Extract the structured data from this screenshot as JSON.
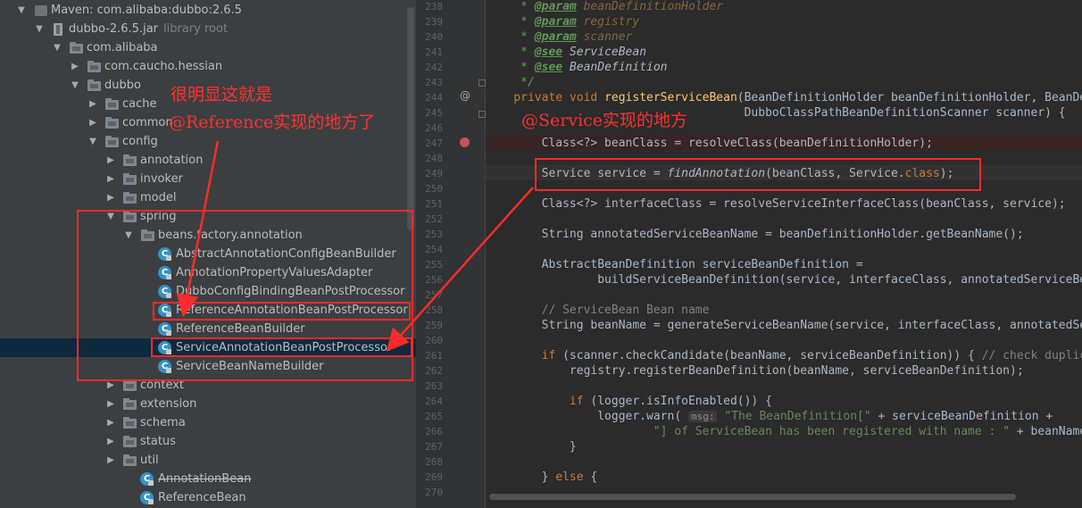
{
  "tree": {
    "items": [
      {
        "label": "Maven: com.alibaba:dubbo:2.6.5",
        "secondary": "",
        "icon": "maven-library-icon",
        "arrow": "▼",
        "depth": 0,
        "kind": "maven"
      },
      {
        "label": "dubbo-2.6.5.jar",
        "secondary": "library root",
        "icon": "jar-icon",
        "arrow": "▼",
        "depth": 1,
        "kind": "jar"
      },
      {
        "label": "com.alibaba",
        "secondary": "",
        "icon": "package-icon",
        "arrow": "▼",
        "depth": 2,
        "kind": "pkg"
      },
      {
        "label": "com.caucho.hessian",
        "secondary": "",
        "icon": "package-icon",
        "arrow": "▶",
        "depth": 3,
        "kind": "pkg"
      },
      {
        "label": "dubbo",
        "secondary": "",
        "icon": "package-icon",
        "arrow": "▼",
        "depth": 3,
        "kind": "pkg"
      },
      {
        "label": "cache",
        "secondary": "",
        "icon": "package-icon",
        "arrow": "▶",
        "depth": 4,
        "kind": "pkg"
      },
      {
        "label": "common",
        "secondary": "",
        "icon": "package-icon",
        "arrow": "▶",
        "depth": 4,
        "kind": "pkg"
      },
      {
        "label": "config",
        "secondary": "",
        "icon": "package-icon",
        "arrow": "▼",
        "depth": 4,
        "kind": "pkg"
      },
      {
        "label": "annotation",
        "secondary": "",
        "icon": "package-icon",
        "arrow": "▶",
        "depth": 5,
        "kind": "pkg"
      },
      {
        "label": "invoker",
        "secondary": "",
        "icon": "package-icon",
        "arrow": "▶",
        "depth": 5,
        "kind": "pkg"
      },
      {
        "label": "model",
        "secondary": "",
        "icon": "package-icon",
        "arrow": "▶",
        "depth": 5,
        "kind": "pkg"
      },
      {
        "label": "spring",
        "secondary": "",
        "icon": "package-icon",
        "arrow": "▼",
        "depth": 5,
        "kind": "pkg"
      },
      {
        "label": "beans.factory.annotation",
        "secondary": "",
        "icon": "package-icon",
        "arrow": "▼",
        "depth": 6,
        "kind": "pkg"
      },
      {
        "label": "AbstractAnnotationConfigBeanBuilder",
        "secondary": "",
        "icon": "class-icon",
        "arrow": "",
        "depth": 7,
        "kind": "cls"
      },
      {
        "label": "AnnotationPropertyValuesAdapter",
        "secondary": "",
        "icon": "class-icon",
        "arrow": "",
        "depth": 7,
        "kind": "cls"
      },
      {
        "label": "DubboConfigBindingBeanPostProcessor",
        "secondary": "",
        "icon": "class-icon",
        "arrow": "",
        "depth": 7,
        "kind": "cls"
      },
      {
        "label": "ReferenceAnnotationBeanPostProcessor",
        "secondary": "",
        "icon": "class-icon",
        "arrow": "",
        "depth": 7,
        "kind": "cls"
      },
      {
        "label": "ReferenceBeanBuilder",
        "secondary": "",
        "icon": "class-icon",
        "arrow": "",
        "depth": 7,
        "kind": "cls"
      },
      {
        "label": "ServiceAnnotationBeanPostProcessor",
        "secondary": "",
        "icon": "class-icon",
        "arrow": "",
        "depth": 7,
        "kind": "cls",
        "selected": true
      },
      {
        "label": "ServiceBeanNameBuilder",
        "secondary": "",
        "icon": "class-icon",
        "arrow": "",
        "depth": 7,
        "kind": "cls"
      },
      {
        "label": "context",
        "secondary": "",
        "icon": "package-icon",
        "arrow": "▶",
        "depth": 5,
        "kind": "pkg"
      },
      {
        "label": "extension",
        "secondary": "",
        "icon": "package-icon",
        "arrow": "▶",
        "depth": 5,
        "kind": "pkg"
      },
      {
        "label": "schema",
        "secondary": "",
        "icon": "package-icon",
        "arrow": "▶",
        "depth": 5,
        "kind": "pkg"
      },
      {
        "label": "status",
        "secondary": "",
        "icon": "package-icon",
        "arrow": "▶",
        "depth": 5,
        "kind": "pkg"
      },
      {
        "label": "util",
        "secondary": "",
        "icon": "package-icon",
        "arrow": "▶",
        "depth": 5,
        "kind": "pkg"
      },
      {
        "label": "AnnotationBean",
        "secondary": "",
        "icon": "class-icon",
        "arrow": "",
        "depth": 6,
        "kind": "cls",
        "deprecated": true
      },
      {
        "label": "ReferenceBean",
        "secondary": "",
        "icon": "class-icon",
        "arrow": "",
        "depth": 6,
        "kind": "cls"
      }
    ]
  },
  "editor": {
    "line_numbers": [
      "238",
      "239",
      "240",
      "241",
      "242",
      "243",
      "244",
      "245",
      "246",
      "247",
      "248",
      "249",
      "250",
      "251",
      "252",
      "253",
      "254",
      "255",
      "256",
      "257",
      "258",
      "259",
      "260",
      "261",
      "262",
      "263",
      "264",
      "265",
      "266",
      "267",
      "268",
      "269",
      "270"
    ],
    "code": [
      [
        [
          "jd",
          "     * "
        ],
        [
          "jt",
          "@param"
        ],
        [
          "jp",
          " beanDefinitionHolder"
        ]
      ],
      [
        [
          "jd",
          "     * "
        ],
        [
          "jt",
          "@param"
        ],
        [
          "jp",
          " registry"
        ]
      ],
      [
        [
          "jd",
          "     * "
        ],
        [
          "jt",
          "@param"
        ],
        [
          "jp",
          " scanner"
        ]
      ],
      [
        [
          "jd",
          "     * "
        ],
        [
          "jt",
          "@see"
        ],
        [
          "jr",
          " ServiceBean"
        ]
      ],
      [
        [
          "jd",
          "     * "
        ],
        [
          "jt",
          "@see"
        ],
        [
          "jr",
          " BeanDefinition"
        ]
      ],
      [
        [
          "jd",
          "     */"
        ]
      ],
      [
        [
          "k",
          "    private void "
        ],
        [
          "f",
          "registerServiceBean"
        ],
        [
          "",
          "(BeanDefinitionHolder beanDefinitionHolder, BeanDefinitionRegistry registry,"
        ]
      ],
      [
        [
          "",
          "                                     DubboClassPathBeanDefinitionScanner scanner) {"
        ]
      ],
      [
        [
          "",
          ""
        ]
      ],
      [
        [
          "",
          "        Class<?> beanClass = resolveClass(beanDefinitionHolder);"
        ]
      ],
      [
        [
          "",
          ""
        ]
      ],
      [
        [
          "",
          "        Service service = "
        ],
        [
          "fi",
          "findAnnotation"
        ],
        [
          "",
          "(beanClass, Service."
        ],
        [
          "k",
          "class"
        ],
        [
          "",
          ");"
        ]
      ],
      [
        [
          "",
          ""
        ]
      ],
      [
        [
          "",
          "        Class<?> interfaceClass = resolveServiceInterfaceClass(beanClass, service);"
        ]
      ],
      [
        [
          "",
          ""
        ]
      ],
      [
        [
          "",
          "        String annotatedServiceBeanName = beanDefinitionHolder.getBeanName();"
        ]
      ],
      [
        [
          "",
          ""
        ]
      ],
      [
        [
          "",
          "        AbstractBeanDefinition serviceBeanDefinition ="
        ]
      ],
      [
        [
          "",
          "                buildServiceBeanDefinition(service, interfaceClass, annotatedServiceBeanName);"
        ]
      ],
      [
        [
          "",
          ""
        ]
      ],
      [
        [
          "cm",
          "        // ServiceBean Bean name"
        ]
      ],
      [
        [
          "",
          "        String beanName = generateServiceBeanName(service, interfaceClass, annotatedServiceBeanName);"
        ]
      ],
      [
        [
          "",
          ""
        ]
      ],
      [
        [
          "k",
          "        if "
        ],
        [
          "",
          "(scanner.checkCandidate(beanName, serviceBeanDefinition)) { "
        ],
        [
          "cm",
          "// check duplicated candidate bean"
        ]
      ],
      [
        [
          "",
          "            registry.registerBeanDefinition(beanName, serviceBeanDefinition);"
        ]
      ],
      [
        [
          "",
          ""
        ]
      ],
      [
        [
          "k",
          "            if "
        ],
        [
          "",
          "(logger.isInfoEnabled()) {"
        ]
      ],
      [
        [
          "",
          "                logger.warn( "
        ],
        [
          "hint",
          "msg:"
        ],
        [
          "",
          " "
        ],
        [
          "s",
          "\"The BeanDefinition[\""
        ],
        [
          "",
          " + serviceBeanDefinition +"
        ]
      ],
      [
        [
          "s",
          "                        \"] of ServiceBean has been registered with name : \""
        ],
        [
          "",
          " + beanName);"
        ]
      ],
      [
        [
          "",
          "            }"
        ]
      ],
      [
        [
          "",
          ""
        ]
      ],
      [
        [
          "",
          "        } "
        ],
        [
          "k",
          "else"
        ],
        [
          "",
          " {"
        ]
      ],
      [
        [
          "",
          ""
        ]
      ]
    ]
  },
  "annotations": {
    "reference_note_line1": "很明显这就是",
    "reference_note_line2": "@Reference实现的地方了",
    "service_note": "@Service实现的地方",
    "color": "#ff2a2a"
  }
}
